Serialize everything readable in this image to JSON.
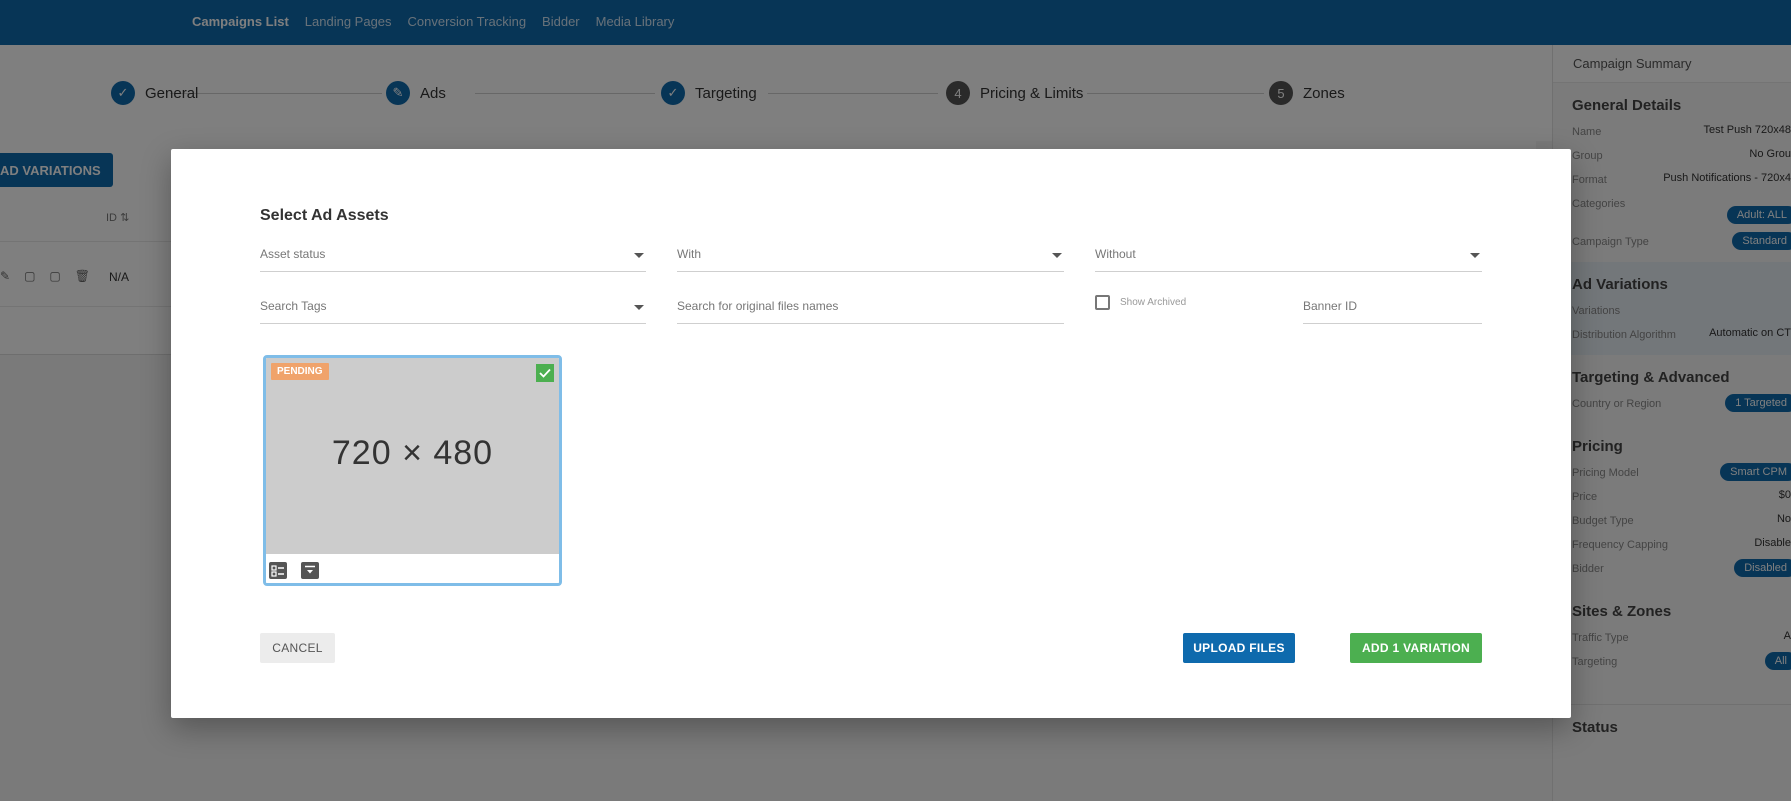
{
  "nav": {
    "items": [
      "Campaigns List",
      "Landing Pages",
      "Conversion Tracking",
      "Bidder",
      "Media Library"
    ],
    "active_index": 0
  },
  "stepper": {
    "steps": [
      {
        "label": "General",
        "status": "done",
        "marker": "✓"
      },
      {
        "label": "Ads",
        "status": "editing",
        "marker": "✎"
      },
      {
        "label": "Targeting",
        "status": "done",
        "marker": "✓"
      },
      {
        "label": "Pricing & Limits",
        "status": "pending",
        "marker": "4"
      },
      {
        "label": "Zones",
        "status": "pending",
        "marker": "5"
      }
    ]
  },
  "background": {
    "add_variations_button": "AD VARIATIONS",
    "id_column": "ID",
    "row_id_value": "N/A"
  },
  "summary": {
    "title": "Campaign Summary",
    "general": {
      "heading": "General Details",
      "name_label": "Name",
      "name_value": "Test Push 720x48",
      "group_label": "Group",
      "group_value": "No Grou",
      "format_label": "Format",
      "format_value": "Push Notifications - 720x4",
      "categories_label": "Categories",
      "categories_value": "Adult: ALL",
      "campaign_type_label": "Campaign Type",
      "campaign_type_value": "Standard"
    },
    "ad_variations": {
      "heading": "Ad Variations",
      "variations_label": "Variations",
      "distribution_label": "Distribution Algorithm",
      "distribution_value": "Automatic on CT"
    },
    "targeting": {
      "heading": "Targeting & Advanced",
      "country_label": "Country or Region",
      "country_value": "1 Targeted"
    },
    "pricing": {
      "heading": "Pricing",
      "model_label": "Pricing Model",
      "model_value": "Smart CPM",
      "price_label": "Price",
      "price_value": "$0",
      "budget_label": "Budget Type",
      "budget_value": "No",
      "frequency_label": "Frequency Capping",
      "frequency_value": "Disable",
      "bidder_label": "Bidder",
      "bidder_value": "Disabled"
    },
    "sites": {
      "heading": "Sites & Zones",
      "traffic_label": "Traffic Type",
      "traffic_value": "A",
      "targeting_label": "Targeting",
      "targeting_value": "All"
    },
    "status": {
      "heading": "Status"
    }
  },
  "modal": {
    "title": "Select Ad Assets",
    "filters": {
      "asset_status": "Asset status",
      "with": "With",
      "without": "Without",
      "search_tags": "Search Tags",
      "search_files": "Search for original files names",
      "show_archived": "Show Archived",
      "banner_id": "Banner ID"
    },
    "asset": {
      "status_badge": "PENDING",
      "dimensions": "720 × 480",
      "selected": true
    },
    "buttons": {
      "cancel": "CANCEL",
      "upload": "UPLOAD FILES",
      "add": "ADD 1 VARIATION"
    }
  },
  "colors": {
    "brand_blue": "#0e6aad",
    "pending_orange": "#f0a36b",
    "success_green": "#4caf50",
    "selected_border": "#7fbde8"
  }
}
